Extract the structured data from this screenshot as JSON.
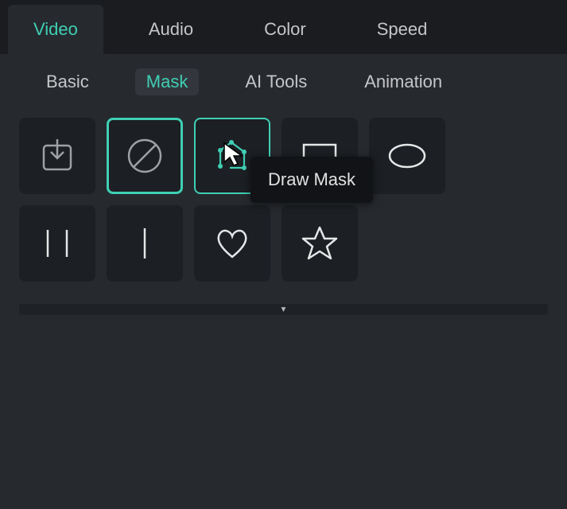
{
  "topTabs": {
    "video": "Video",
    "audio": "Audio",
    "color": "Color",
    "speed": "Speed"
  },
  "subTabs": {
    "basic": "Basic",
    "mask": "Mask",
    "aitools": "AI Tools",
    "animation": "Animation"
  },
  "maskTiles": {
    "import": "import-icon",
    "none": "none-icon",
    "draw": "draw-mask-icon",
    "rect": "rectangle-icon",
    "ellipse": "ellipse-icon",
    "dualbar": "dual-bar-icon",
    "singlebar": "single-bar-icon",
    "heart": "heart-icon",
    "star": "star-icon"
  },
  "tooltip": "Draw Mask",
  "colors": {
    "accent": "#3fcfb4",
    "panel": "#26292e",
    "tile": "#1c1f23",
    "text": "#c5c6c8"
  }
}
